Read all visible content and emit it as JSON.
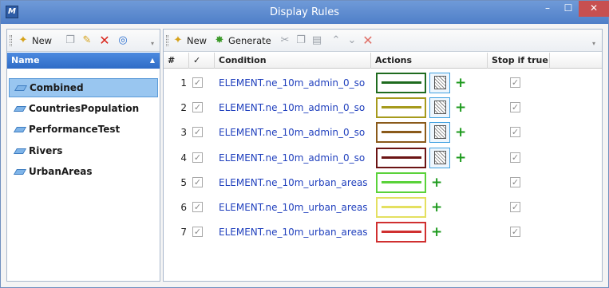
{
  "window": {
    "title": "Display Rules",
    "app_icon": "microstation-icon",
    "controls": {
      "minimize": "–",
      "maximize": "☐",
      "close": "✕"
    }
  },
  "left_toolbar": {
    "new_label": "New"
  },
  "right_toolbar": {
    "new_label": "New",
    "generate_label": "Generate"
  },
  "rule_sets": {
    "header": "Name",
    "items": [
      {
        "label": "Combined",
        "selected": true
      },
      {
        "label": "CountriesPopulation",
        "selected": false
      },
      {
        "label": "PerformanceTest",
        "selected": false
      },
      {
        "label": "Rivers",
        "selected": false
      },
      {
        "label": "UrbanAreas",
        "selected": false
      }
    ]
  },
  "rules_grid": {
    "columns": {
      "number": "#",
      "enabled": "✓",
      "condition": "Condition",
      "actions": "Actions",
      "stop": "Stop if true"
    },
    "rows": [
      {
        "num": "1",
        "enabled": true,
        "condition": "ELEMENT.ne_10m_admin_0_so",
        "border_color": "#1f6b1f",
        "line_color": "#1f6b1f",
        "has_fill": true,
        "stop": true
      },
      {
        "num": "2",
        "enabled": true,
        "condition": "ELEMENT.ne_10m_admin_0_so",
        "border_color": "#a69a1c",
        "line_color": "#a69a1c",
        "has_fill": true,
        "stop": true
      },
      {
        "num": "3",
        "enabled": true,
        "condition": "ELEMENT.ne_10m_admin_0_so",
        "border_color": "#8a5a1a",
        "line_color": "#8a5a1a",
        "has_fill": true,
        "stop": true
      },
      {
        "num": "4",
        "enabled": true,
        "condition": "ELEMENT.ne_10m_admin_0_so",
        "border_color": "#6b1414",
        "line_color": "#6b1414",
        "has_fill": true,
        "stop": true
      },
      {
        "num": "5",
        "enabled": true,
        "condition": "ELEMENT.ne_10m_urban_areas",
        "border_color": "#5ad23a",
        "line_color": "#5ad23a",
        "has_fill": false,
        "stop": true
      },
      {
        "num": "6",
        "enabled": true,
        "condition": "ELEMENT.ne_10m_urban_areas",
        "border_color": "#e4e060",
        "line_color": "#e4e060",
        "has_fill": false,
        "stop": true
      },
      {
        "num": "7",
        "enabled": true,
        "condition": "ELEMENT.ne_10m_urban_areas",
        "border_color": "#d03030",
        "line_color": "#d03030",
        "has_fill": false,
        "stop": true
      }
    ]
  }
}
